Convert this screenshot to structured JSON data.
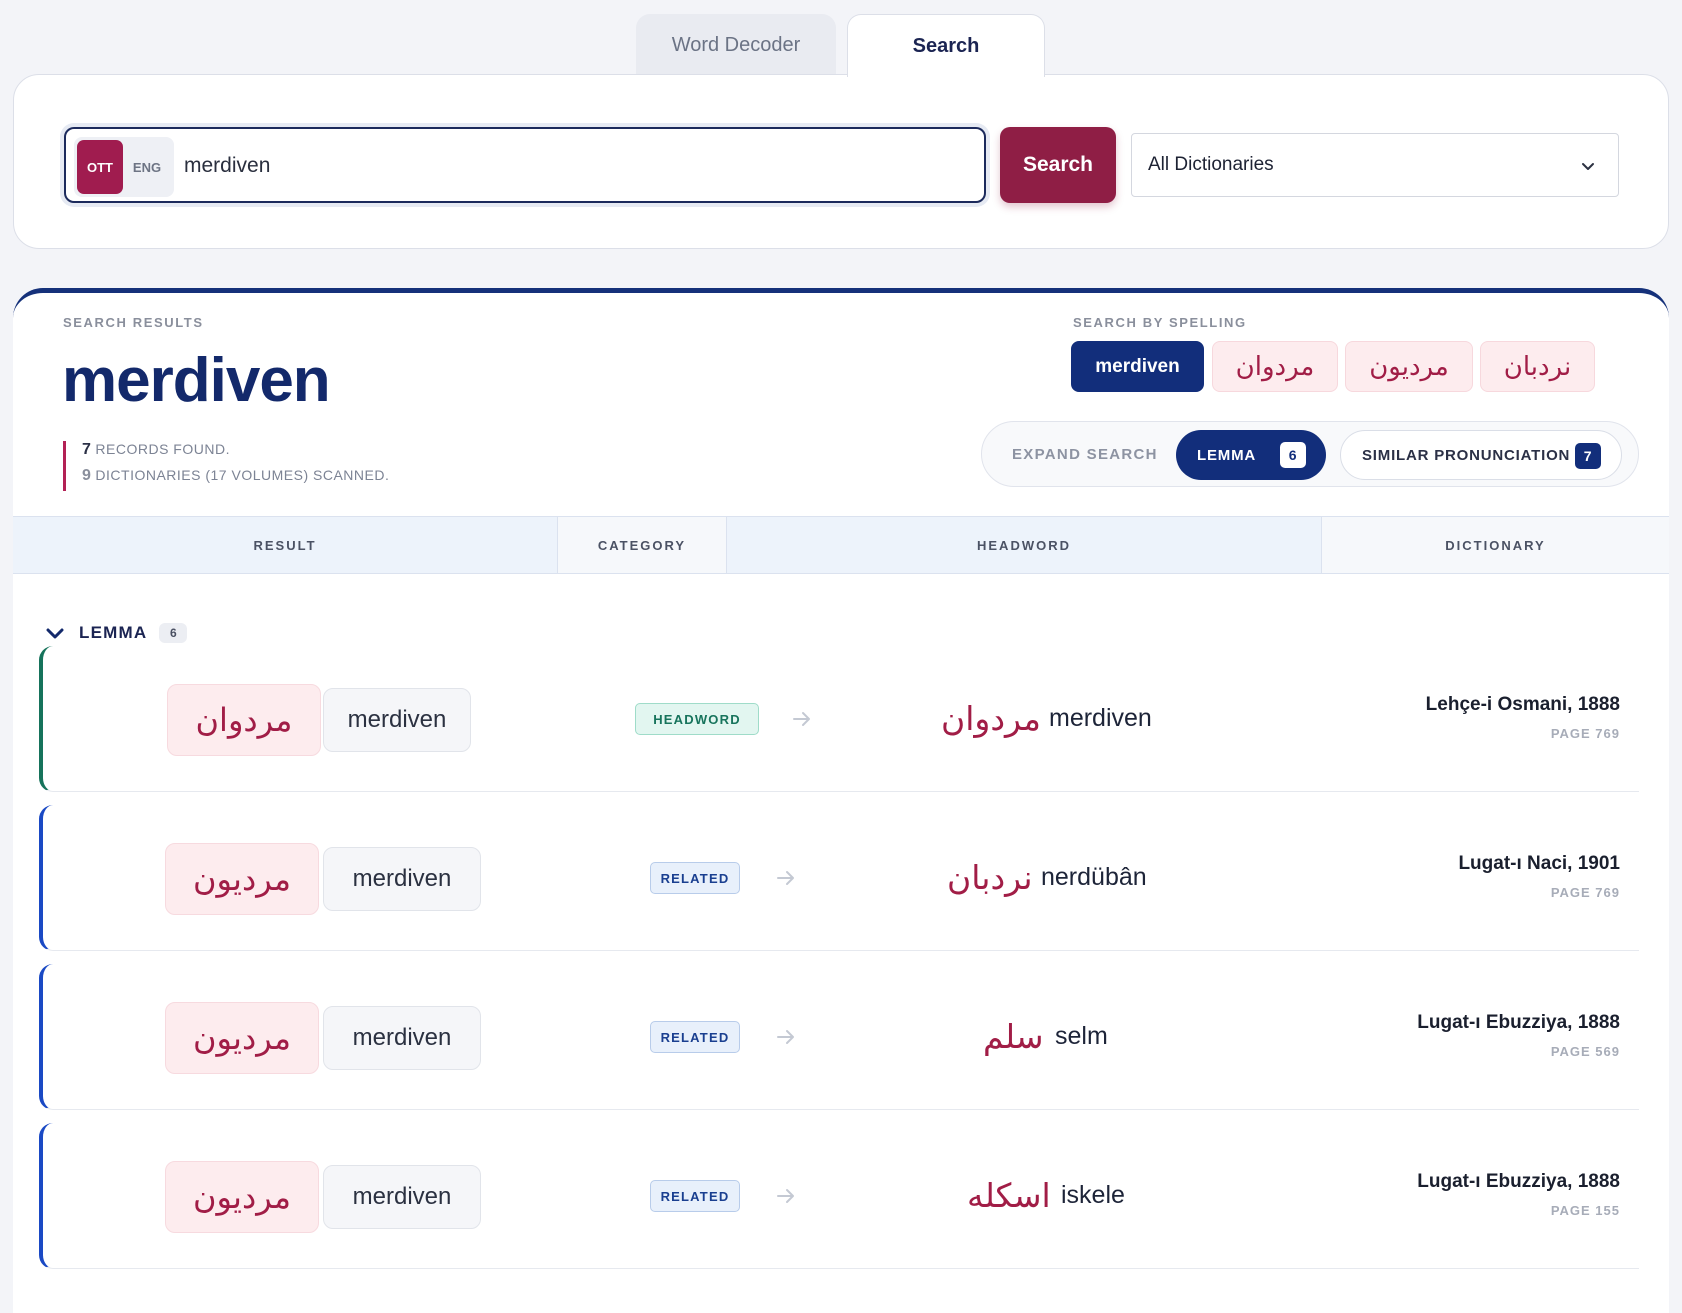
{
  "tabs": [
    {
      "label": "Word Decoder",
      "active": false
    },
    {
      "label": "Search",
      "active": true
    }
  ],
  "search": {
    "lang_ott": "OTT",
    "lang_eng": "ENG",
    "query": "merdiven",
    "button_label": "Search",
    "dictionary_select": "All Dictionaries"
  },
  "results": {
    "eyebrow": "SEARCH RESULTS",
    "title": "merdiven",
    "records_count": "7",
    "records_label": "RECORDS FOUND.",
    "dict_count": "9",
    "dict_label": "DICTIONARIES (17 VOLUMES) SCANNED.",
    "spelling_eyebrow": "SEARCH BY SPELLING",
    "spellings": [
      "merdiven",
      "مردوان",
      "مرديون",
      "نردبان"
    ],
    "expand_label": "EXPAND SEARCH",
    "lemma_label": "LEMMA",
    "lemma_count": "6",
    "similar_label": "SIMILAR PRONUNCIATION",
    "similar_count": "7"
  },
  "table": {
    "headers": [
      "RESULT",
      "CATEGORY",
      "HEADWORD",
      "DICTIONARY"
    ]
  },
  "group": {
    "label": "LEMMA",
    "count": "6"
  },
  "rows": [
    {
      "result_ott": "مردوان",
      "result_lat": "merdiven",
      "category": "HEADWORD",
      "headword_ott": "مردوان",
      "headword_lat": "merdiven",
      "dictionary": "Lehçe-i Osmani, 1888",
      "page": "PAGE 769"
    },
    {
      "result_ott": "مرديون",
      "result_lat": "merdiven",
      "category": "RELATED",
      "headword_ott": "نردبان",
      "headword_lat": "nerdübân",
      "dictionary": "Lugat-ı Naci, 1901",
      "page": "PAGE 769"
    },
    {
      "result_ott": "مرديون",
      "result_lat": "merdiven",
      "category": "RELATED",
      "headword_ott": "سلم",
      "headword_lat": "selm",
      "dictionary": "Lugat-ı Ebuzziya, 1888",
      "page": "PAGE 569"
    },
    {
      "result_ott": "مرديون",
      "result_lat": "merdiven",
      "category": "RELATED",
      "headword_ott": "اسكله",
      "headword_lat": "iskele",
      "dictionary": "Lugat-ı Ebuzziya, 1888",
      "page": "PAGE 155"
    }
  ],
  "colors": {
    "primary_navy": "#122e7b",
    "accent_crimson": "#8f1e45",
    "ottoman_text": "#a11d46",
    "headword_green": "#16735b",
    "related_blue": "#1a49c4"
  }
}
